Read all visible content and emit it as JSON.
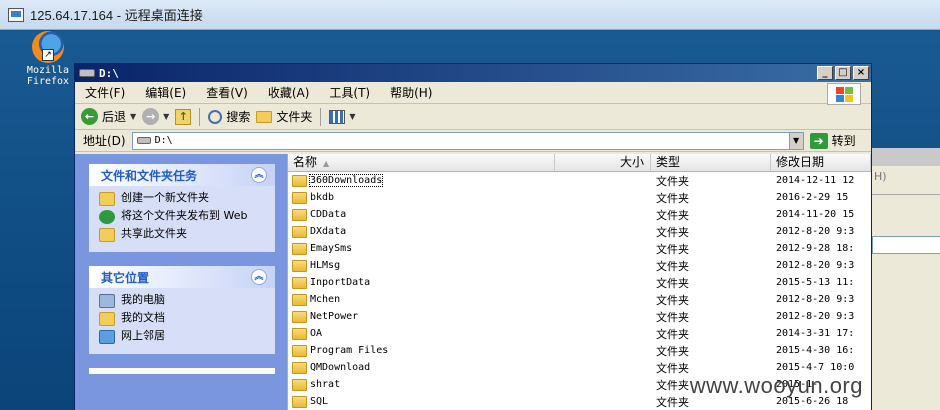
{
  "rdp": {
    "title": "125.64.17.164 - 远程桌面连接"
  },
  "desktop": {
    "firefox_label": "Mozilla Firefox"
  },
  "bgwin": {
    "menu_letter": "H)"
  },
  "window": {
    "title": "D:\\"
  },
  "menu": [
    "文件(F)",
    "编辑(E)",
    "查看(V)",
    "收藏(A)",
    "工具(T)",
    "帮助(H)"
  ],
  "toolbar": {
    "back": "后退",
    "search": "搜索",
    "folders": "文件夹"
  },
  "address": {
    "label": "地址(D)",
    "value": "D:\\",
    "go": "转到"
  },
  "taskpane": {
    "tasks_title": "文件和文件夹任务",
    "tasks": [
      "创建一个新文件夹",
      "将这个文件夹发布到 Web",
      "共享此文件夹"
    ],
    "places_title": "其它位置",
    "places": [
      "我的电脑",
      "我的文档",
      "网上邻居"
    ]
  },
  "columns": {
    "name": "名称",
    "size": "大小",
    "type": "类型",
    "date": "修改日期"
  },
  "files": [
    {
      "name": "360Downloads",
      "type": "文件夹",
      "date": "2014-12-11 12"
    },
    {
      "name": "bkdb",
      "type": "文件夹",
      "date": "2016-2-29 15"
    },
    {
      "name": "CDData",
      "type": "文件夹",
      "date": "2014-11-20 15"
    },
    {
      "name": "DXdata",
      "type": "文件夹",
      "date": "2012-8-20 9:3"
    },
    {
      "name": "EmaySms",
      "type": "文件夹",
      "date": "2012-9-28 18:"
    },
    {
      "name": "HLMsg",
      "type": "文件夹",
      "date": "2012-8-20 9:3"
    },
    {
      "name": "InportData",
      "type": "文件夹",
      "date": "2015-5-13 11:"
    },
    {
      "name": "Mchen",
      "type": "文件夹",
      "date": "2012-8-20 9:3"
    },
    {
      "name": "NetPower",
      "type": "文件夹",
      "date": "2012-8-20 9:3"
    },
    {
      "name": "OA",
      "type": "文件夹",
      "date": "2014-3-31 17:"
    },
    {
      "name": "Program Files",
      "type": "文件夹",
      "date": "2015-4-30 16:"
    },
    {
      "name": "QMDownload",
      "type": "文件夹",
      "date": "2015-4-7 10:0"
    },
    {
      "name": "shrat",
      "type": "文件夹",
      "date": "2015-1-"
    },
    {
      "name": "SQL",
      "type": "文件夹",
      "date": "2015-6-26 18"
    }
  ],
  "watermark": "www.wooyun.org"
}
